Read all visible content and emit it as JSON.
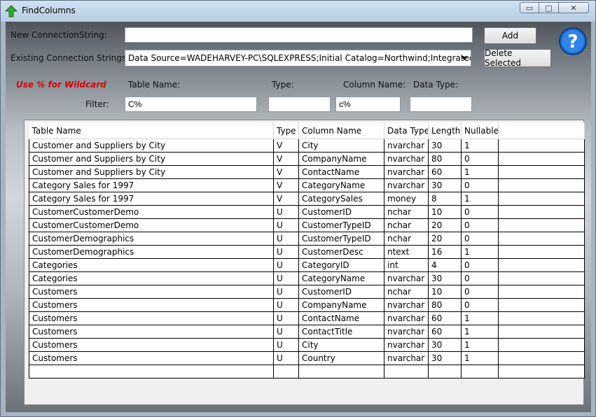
{
  "window": {
    "title": "FindColumns",
    "buttons": {
      "minimize": "▭",
      "maximize": "□",
      "close": "✕"
    }
  },
  "connection": {
    "new_label": "New ConnectionString:",
    "new_value": "",
    "add_label": "Add",
    "existing_label": "Existing Connection Strings:",
    "existing_selected": "Data Source=WADEHARVEY-PC\\SQLEXPRESS;Initial Catalog=Northwind;Integrated",
    "delete_label": "Delete Selected"
  },
  "filter": {
    "wildcard_hint": "Use % for Wildcard",
    "row_label": "Filter:",
    "table_name_label": "Table Name:",
    "type_label": "Type:",
    "column_name_label": "Column Name:",
    "data_type_label": "Data Type:",
    "table_name_value": "C%",
    "type_value": "",
    "column_name_value": "c%",
    "data_type_value": ""
  },
  "grid": {
    "headers": [
      "Table Name",
      "Type",
      "Column Name",
      "Data Type",
      "Length",
      "Nullable"
    ],
    "rows": [
      [
        "Customer and Suppliers by City",
        "V",
        "City",
        "nvarchar",
        "30",
        "1"
      ],
      [
        "Customer and Suppliers by City",
        "V",
        "CompanyName",
        "nvarchar",
        "80",
        "0"
      ],
      [
        "Customer and Suppliers by City",
        "V",
        "ContactName",
        "nvarchar",
        "60",
        "1"
      ],
      [
        "Category Sales for 1997",
        "V",
        "CategoryName",
        "nvarchar",
        "30",
        "0"
      ],
      [
        "Category Sales for 1997",
        "V",
        "CategorySales",
        "money",
        "8",
        "1"
      ],
      [
        "CustomerCustomerDemo",
        "U",
        "CustomerID",
        "nchar",
        "10",
        "0"
      ],
      [
        "CustomerCustomerDemo",
        "U",
        "CustomerTypeID",
        "nchar",
        "20",
        "0"
      ],
      [
        "CustomerDemographics",
        "U",
        "CustomerTypeID",
        "nchar",
        "20",
        "0"
      ],
      [
        "CustomerDemographics",
        "U",
        "CustomerDesc",
        "ntext",
        "16",
        "1"
      ],
      [
        "Categories",
        "U",
        "CategoryID",
        "int",
        "4",
        "0"
      ],
      [
        "Categories",
        "U",
        "CategoryName",
        "nvarchar",
        "30",
        "0"
      ],
      [
        "Customers",
        "U",
        "CustomerID",
        "nchar",
        "10",
        "0"
      ],
      [
        "Customers",
        "U",
        "CompanyName",
        "nvarchar",
        "80",
        "0"
      ],
      [
        "Customers",
        "U",
        "ContactName",
        "nvarchar",
        "60",
        "1"
      ],
      [
        "Customers",
        "U",
        "ContactTitle",
        "nvarchar",
        "60",
        "1"
      ],
      [
        "Customers",
        "U",
        "City",
        "nvarchar",
        "30",
        "1"
      ],
      [
        "Customers",
        "U",
        "Country",
        "nvarchar",
        "30",
        "1"
      ],
      [
        "",
        "",
        "",
        "",
        "",
        ""
      ]
    ]
  },
  "icons": {
    "app": "up-arrow-icon",
    "help": "help-icon"
  },
  "colors": {
    "hint_red": "#e00000",
    "help_blue": "#1a6ad0"
  }
}
